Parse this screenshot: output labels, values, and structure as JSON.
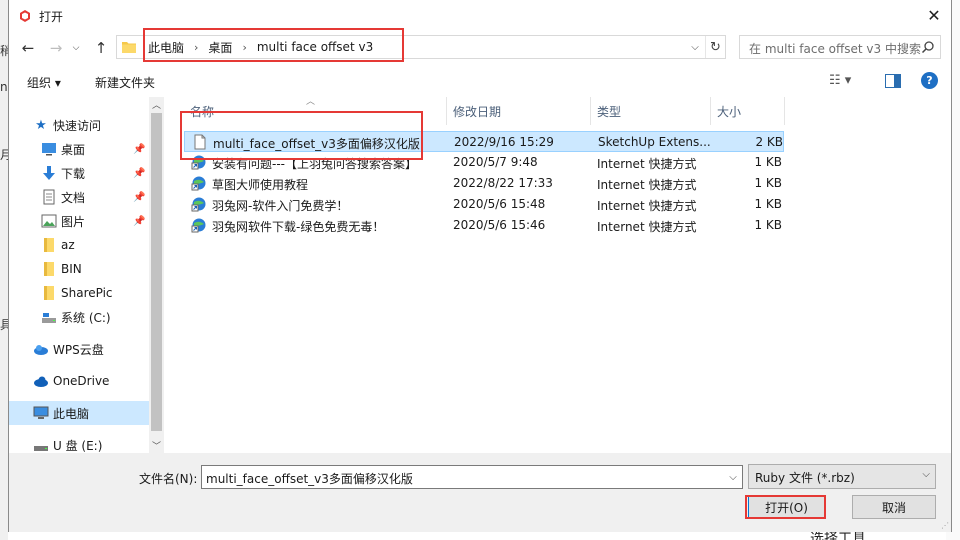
{
  "window": {
    "title": "打开"
  },
  "background": {
    "left_chars": [
      "稍",
      "n",
      "月",
      "具"
    ],
    "bottom_text": "选择工具"
  },
  "nav": {
    "back": "←",
    "forward": "→",
    "up": "↑"
  },
  "address": {
    "crumbs": [
      "此电脑",
      "桌面",
      "multi face offset v3"
    ],
    "sep": "›",
    "dropdown": "⌵",
    "refresh": "↻"
  },
  "search": {
    "placeholder": "在 multi face offset v3 中搜索"
  },
  "toolbar": {
    "organize": "组织 ▾",
    "new_folder": "新建文件夹",
    "view_menu": "☷ ▾",
    "help": "?"
  },
  "sidebar": {
    "items": [
      {
        "label": "快速访问",
        "icon": "star-icon",
        "pinned": false
      },
      {
        "label": "桌面",
        "icon": "desktop-icon",
        "pinned": true
      },
      {
        "label": "下载",
        "icon": "download-icon",
        "pinned": true
      },
      {
        "label": "文档",
        "icon": "document-icon",
        "pinned": true
      },
      {
        "label": "图片",
        "icon": "picture-icon",
        "pinned": true
      },
      {
        "label": "az",
        "icon": "folder-icon",
        "pinned": false
      },
      {
        "label": "BIN",
        "icon": "folder-icon",
        "pinned": false
      },
      {
        "label": "SharePic",
        "icon": "folder-icon",
        "pinned": false
      },
      {
        "label": "系统 (C:)",
        "icon": "drive-icon",
        "pinned": false
      },
      {
        "label": "WPS云盘",
        "icon": "cloud-icon",
        "pinned": false
      },
      {
        "label": "OneDrive",
        "icon": "cloud-icon",
        "pinned": false
      },
      {
        "label": "此电脑",
        "icon": "computer-icon",
        "pinned": false,
        "selected": true
      },
      {
        "label": "U 盘 (E:)",
        "icon": "usb-drive-icon",
        "pinned": false
      }
    ]
  },
  "columns": {
    "name": "名称",
    "modified": "修改日期",
    "type": "类型",
    "size": "大小"
  },
  "files": [
    {
      "name": "multi_face_offset_v3多面偏移汉化版",
      "modified": "2022/9/16 15:29",
      "type": "SketchUp Extens...",
      "size": "2 KB",
      "icon": "file-icon",
      "selected": true
    },
    {
      "name": "安装有问题---【上羽兔问答搜索答案】",
      "modified": "2020/5/7 9:48",
      "type": "Internet 快捷方式",
      "size": "1 KB",
      "icon": "internet-shortcut-icon"
    },
    {
      "name": "草图大师使用教程",
      "modified": "2022/8/22 17:33",
      "type": "Internet 快捷方式",
      "size": "1 KB",
      "icon": "internet-shortcut-icon"
    },
    {
      "name": "羽兔网-软件入门免费学！",
      "modified": "2020/5/6 15:48",
      "type": "Internet 快捷方式",
      "size": "1 KB",
      "icon": "internet-shortcut-icon"
    },
    {
      "name": "羽兔网软件下载-绿色免费无毒！",
      "modified": "2020/5/6 15:46",
      "type": "Internet 快捷方式",
      "size": "1 KB",
      "icon": "internet-shortcut-icon"
    }
  ],
  "footer": {
    "filename_label": "文件名(N):",
    "filename_value": "multi_face_offset_v3多面偏移汉化版",
    "filetype": "Ruby 文件 (*.rbz)",
    "open": "打开(O)",
    "cancel": "取消"
  },
  "colors": {
    "selection": "#cce8ff",
    "highlight": "#e53935",
    "accent": "#0078d7"
  }
}
